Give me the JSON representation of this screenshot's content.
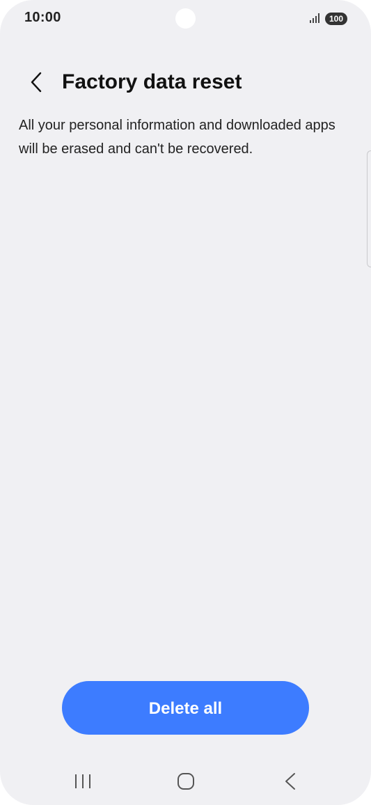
{
  "status_bar": {
    "time": "10:00",
    "battery": "100",
    "icons": [
      "signal-icon",
      "battery-icon"
    ]
  },
  "header": {
    "back_icon": "chevron-left-icon",
    "title": "Factory data reset"
  },
  "main": {
    "description": "All your personal information and downloaded apps will be erased and can't be recovered."
  },
  "actions": {
    "delete_label": "Delete all",
    "accent_color": "#3d7cff"
  },
  "nav_bar": {
    "icons": [
      "recent-apps-icon",
      "home-icon",
      "back-icon"
    ]
  }
}
